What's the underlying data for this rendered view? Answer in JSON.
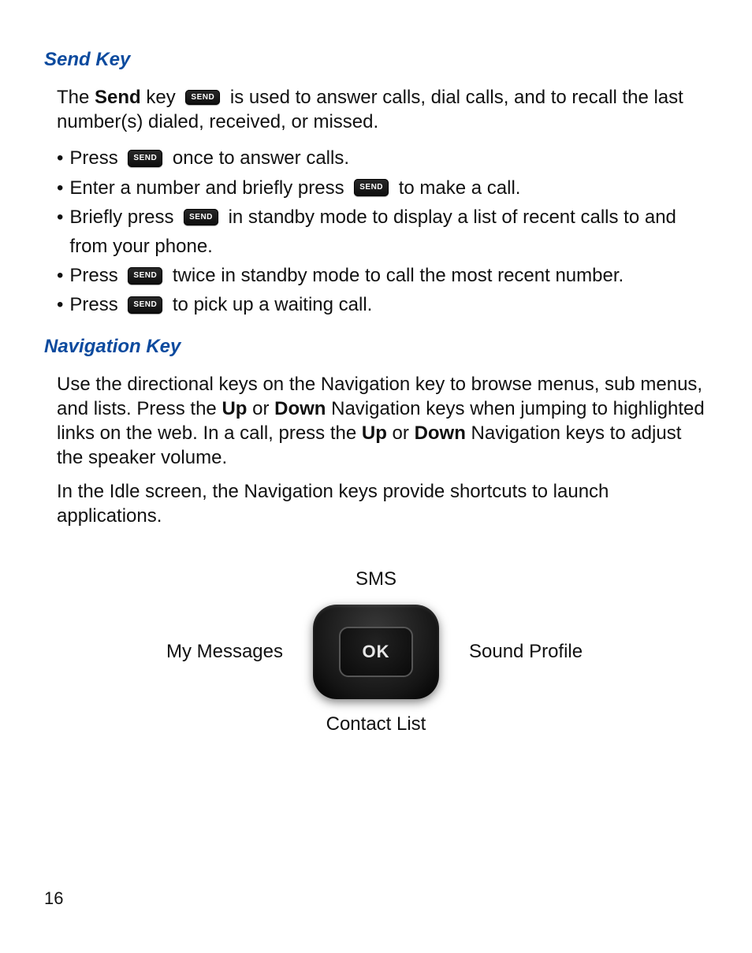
{
  "sendKey": {
    "heading": "Send Key",
    "intro_pre": "The ",
    "intro_bold": "Send",
    "intro_mid": " key ",
    "intro_post": " is used to answer calls, dial calls, and to recall the last number(s) dialed, received, or missed.",
    "badge": "SEND",
    "bullets": {
      "b1_pre": "Press ",
      "b1_post": " once to answer calls.",
      "b2_pre": "Enter a number and briefly press ",
      "b2_post": " to make a call.",
      "b3_pre": "Briefly press ",
      "b3_post": " in standby mode to display a list of recent calls to and from your phone.",
      "b4_pre": "Press ",
      "b4_post": " twice in standby mode to call the most recent number.",
      "b5_pre": "Press ",
      "b5_post": " to pick up a waiting call."
    }
  },
  "navKey": {
    "heading": "Navigation Key",
    "para1_a": "Use the directional keys on the Navigation key to browse menus, sub menus, and lists. Press the ",
    "up": "Up",
    "or": " or ",
    "down": "Down",
    "para1_b": " Navigation keys when jumping to highlighted links on the web. In a call, press the ",
    "para1_c": " Navigation keys to adjust the speaker volume.",
    "para2": "In the Idle screen, the Navigation keys provide shortcuts to launch applications.",
    "diagram": {
      "top": "SMS",
      "left": "My Messages",
      "right": "Sound Profile",
      "bottom": "Contact List",
      "center": "OK"
    }
  },
  "pageNumber": "16"
}
